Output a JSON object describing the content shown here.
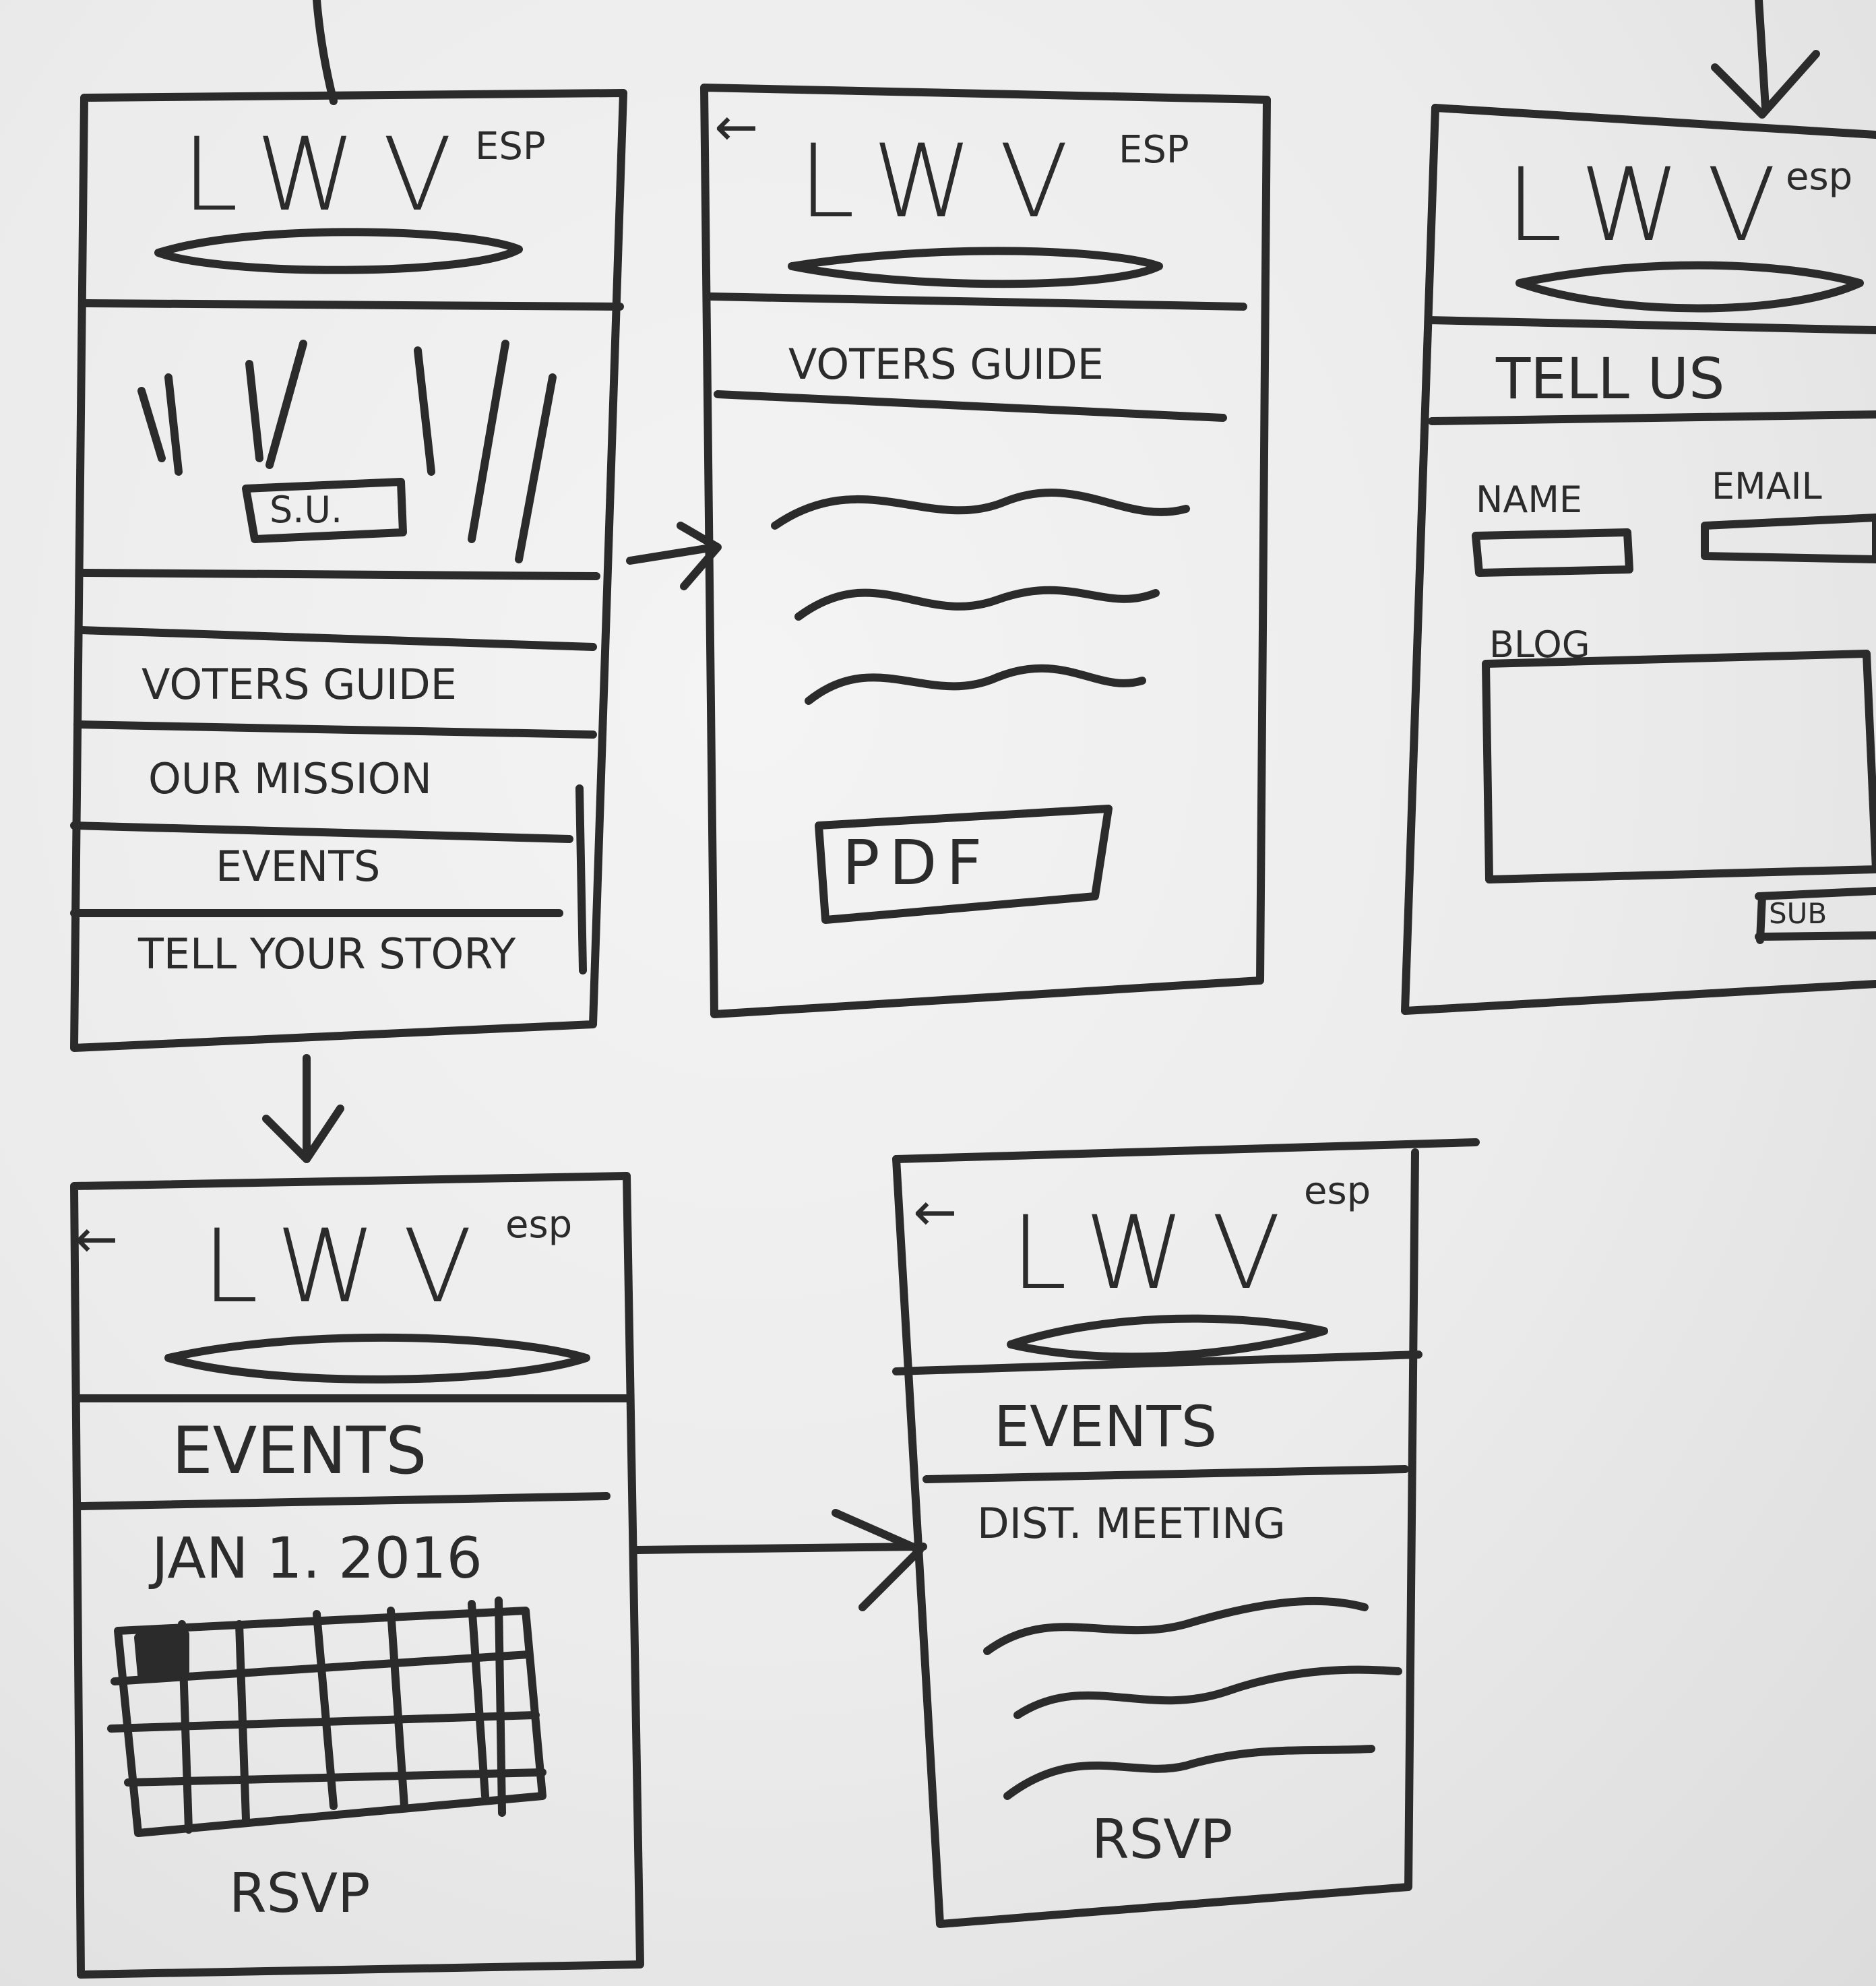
{
  "screens": {
    "home": {
      "logo": "LWV",
      "lang": "ESP",
      "hero_button": "S.U.",
      "menu": [
        "VOTERS GUIDE",
        "OUR MISSION",
        "EVENTS",
        "TELL YOUR STORY"
      ]
    },
    "voters_guide": {
      "back": "←",
      "logo": "LWV",
      "lang": "ESP",
      "title": "VOTERS GUIDE",
      "pdf_button": "PDF"
    },
    "tell_us": {
      "logo": "LWV",
      "lang": "esp",
      "title": "TELL US",
      "name_label": "NAME",
      "email_label": "EMAIL",
      "blog_label": "BLOG",
      "submit": "SUB"
    },
    "events": {
      "back": "←",
      "logo": "LWV",
      "lang": "esp",
      "title": "EVENTS",
      "date": "JAN 1. 2016",
      "rsvp": "RSVP"
    },
    "event_detail": {
      "back": "←",
      "logo": "LWV",
      "lang": "esp",
      "title": "EVENTS",
      "event_name": "DIST. MEETING",
      "rsvp": "RSVP"
    }
  }
}
